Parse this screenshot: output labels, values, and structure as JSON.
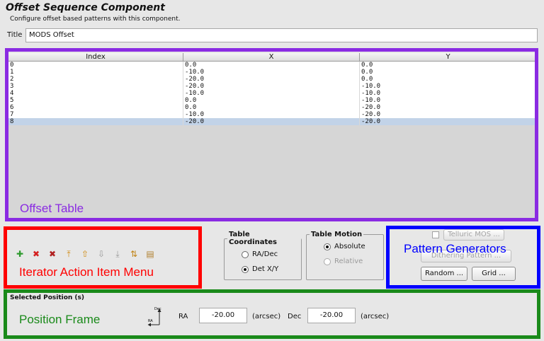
{
  "header": {
    "title": "Offset Sequence Component",
    "subtitle": "Configure offset based patterns with this component."
  },
  "title_field": {
    "label": "Title",
    "value": "MODS Offset"
  },
  "table": {
    "columns": [
      "Index",
      "X",
      "Y"
    ],
    "rows": [
      [
        "0",
        "0.0",
        "0.0"
      ],
      [
        "1",
        "-10.0",
        "0.0"
      ],
      [
        "2",
        "-20.0",
        "0.0"
      ],
      [
        "3",
        "-20.0",
        "-10.0"
      ],
      [
        "4",
        "-10.0",
        "-10.0"
      ],
      [
        "5",
        "0.0",
        "-10.0"
      ],
      [
        "6",
        "0.0",
        "-20.0"
      ],
      [
        "7",
        "-10.0",
        "-20.0"
      ],
      [
        "8",
        "-20.0",
        "-20.0"
      ]
    ],
    "selected_row": 8
  },
  "action_icons": [
    {
      "name": "add-icon",
      "glyph": "✚",
      "color": "#2e9a2e"
    },
    {
      "name": "remove-icon",
      "glyph": "✖",
      "color": "#d42020"
    },
    {
      "name": "remove-all-icon",
      "glyph": "✖",
      "color": "#b02020"
    },
    {
      "name": "move-to-top-icon",
      "glyph": "⤒",
      "color": "#d08a10"
    },
    {
      "name": "move-up-icon",
      "glyph": "⇧",
      "color": "#d08a10"
    },
    {
      "name": "move-down-icon",
      "glyph": "⇩",
      "color": "#999999"
    },
    {
      "name": "move-to-bottom-icon",
      "glyph": "⤓",
      "color": "#999999"
    },
    {
      "name": "sort-icon",
      "glyph": "⇅",
      "color": "#c08010"
    },
    {
      "name": "paste-icon",
      "glyph": "▤",
      "color": "#b08030"
    }
  ],
  "table_coordinates": {
    "label": "Table Coordinates",
    "options": [
      {
        "label": "RA/Dec",
        "selected": false
      },
      {
        "label": "Det X/Y",
        "selected": true
      }
    ]
  },
  "table_motion": {
    "label": "Table Motion",
    "options": [
      {
        "label": "Absolute",
        "selected": true
      },
      {
        "label": "Relative",
        "selected": false,
        "disabled": true
      }
    ]
  },
  "generators": {
    "telluric_label": "Telluric MOS ...",
    "dithering_label": "Dithering Pattern ...",
    "random_label": "Random ...",
    "grid_label": "Grid ..."
  },
  "position": {
    "legend": "Selected Position (s)",
    "axis_dec": "Dec",
    "axis_ra": "RA",
    "ra_label": "RA",
    "ra_value": "-20.00",
    "ra_unit": "(arcsec)",
    "dec_label": "Dec",
    "dec_value": "-20.00",
    "dec_unit": "(arcsec)"
  },
  "overlays": [
    {
      "label": "Offset Table",
      "color": "#8a2be2"
    },
    {
      "label": "Iterator Action Item Menu",
      "color": "#ff0000"
    },
    {
      "label": "Pattern Generators",
      "color": "#0000ff"
    },
    {
      "label": "Position Frame",
      "color": "#1a8a1a"
    }
  ]
}
